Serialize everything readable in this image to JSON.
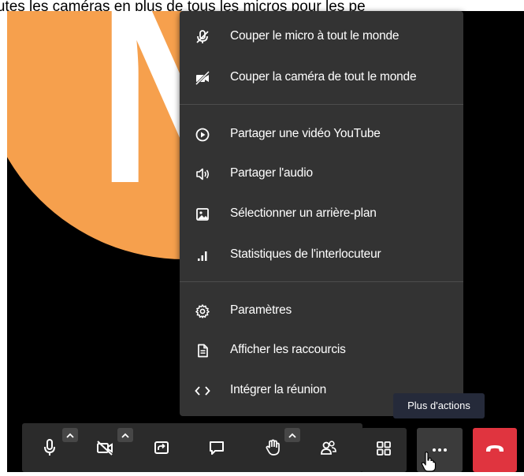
{
  "caption": "toutes les caméras en plus de tous les micros pour les pe",
  "avatar": {
    "letter": "N",
    "color": "#f6a04d"
  },
  "menu": {
    "items": [
      {
        "label": "Couper le micro à tout le monde",
        "icon": "mic-off-icon"
      },
      {
        "label": "Couper la caméra de tout le monde",
        "icon": "camera-off-icon"
      },
      {
        "label": "Partager une vidéo YouTube",
        "icon": "play-circle-icon"
      },
      {
        "label": "Partager l'audio",
        "icon": "speaker-icon"
      },
      {
        "label": "Sélectionner un arrière-plan",
        "icon": "image-icon"
      },
      {
        "label": "Statistiques de l'interlocuteur",
        "icon": "signal-bars-icon"
      },
      {
        "label": "Paramètres",
        "icon": "gear-icon"
      },
      {
        "label": "Afficher les raccourcis",
        "icon": "document-icon"
      },
      {
        "label": "Intégrer la réunion",
        "icon": "code-icon"
      }
    ]
  },
  "tooltip": "Plus d'actions",
  "toolbar": {
    "buttons": [
      "microphone-icon",
      "camera-off-icon",
      "screen-share-icon",
      "chat-icon",
      "raise-hand-icon",
      "participants-icon",
      "tile-view-icon",
      "more-icon",
      "hangup-icon"
    ]
  },
  "colors": {
    "menu_bg": "#333333",
    "toolbar_bg": "#2b2b2b",
    "hangup": "#e0343f",
    "tooltip_bg": "#252a3a"
  }
}
